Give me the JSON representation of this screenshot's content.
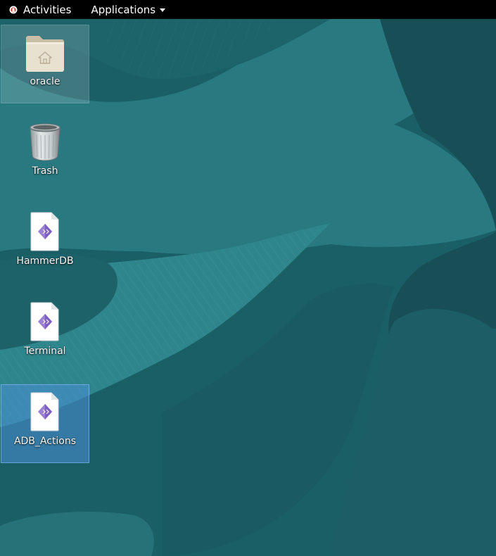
{
  "topbar": {
    "activities_label": "Activities",
    "applications_label": "Applications",
    "logo_icon": "distro-logo-icon",
    "menu_icon": "chevron-down-icon"
  },
  "desktop": {
    "icons": [
      {
        "label": "oracle",
        "icon": "home-folder-icon",
        "state": "hover"
      },
      {
        "label": "Trash",
        "icon": "trash-icon",
        "state": "normal"
      },
      {
        "label": "HammerDB",
        "icon": "script-file-icon",
        "state": "normal"
      },
      {
        "label": "Terminal",
        "icon": "script-file-icon",
        "state": "normal"
      },
      {
        "label": "ADB_Actions",
        "icon": "script-file-icon",
        "state": "selected"
      }
    ]
  },
  "colors": {
    "topbar_bg": "#000000",
    "wallpaper_base": "#1b5f66",
    "wallpaper_light": "#2a7d84",
    "wallpaper_dark": "#15535a",
    "selection": "#4a90d9"
  }
}
